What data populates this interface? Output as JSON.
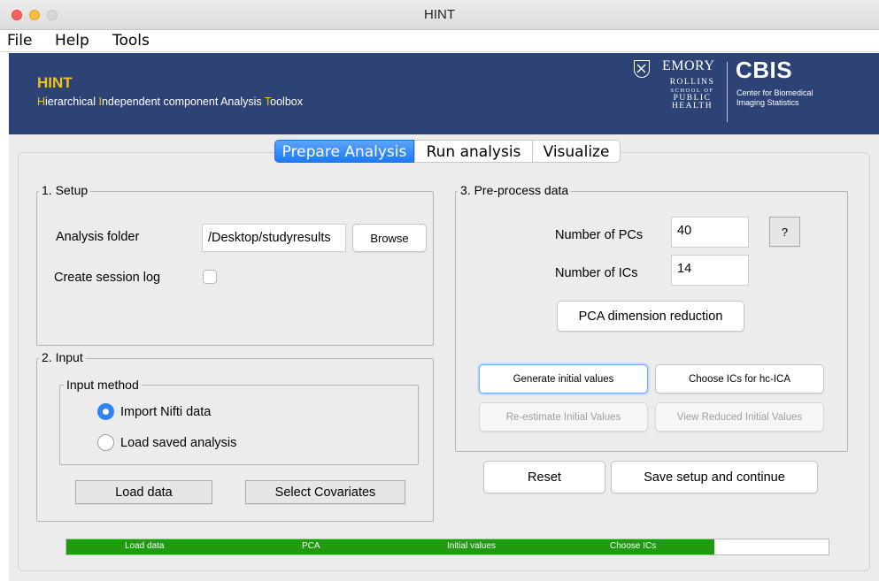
{
  "window": {
    "title": "HINT"
  },
  "menu": {
    "items": [
      "File",
      "Help",
      "Tools"
    ]
  },
  "banner": {
    "app_name": "HINT",
    "full_name_parts": [
      {
        "text": "H",
        "hl": true
      },
      {
        "text": "ierarchical ",
        "hl": false
      },
      {
        "text": "I",
        "hl": true
      },
      {
        "text": "ndependent component Analysis ",
        "hl": false
      },
      {
        "text": "T",
        "hl": true
      },
      {
        "text": "oolbox",
        "hl": false
      }
    ],
    "emory": "EMORY",
    "rollins_lines": [
      "ROLLINS",
      "SCHOOL OF",
      "PUBLIC",
      "HEALTH"
    ],
    "cbis": "CBIS",
    "cbis_sub_lines": [
      "Center for Biomedical",
      "Imaging Statistics"
    ]
  },
  "tabs": [
    {
      "label": "Prepare Analysis",
      "active": true
    },
    {
      "label": "Run analysis",
      "active": false
    },
    {
      "label": "Visualize",
      "active": false
    }
  ],
  "setup": {
    "title": "1. Setup",
    "folder_label": "Analysis folder",
    "folder_value": "/Desktop/studyresults",
    "browse_label": "Browse",
    "session_log_label": "Create session log",
    "session_log_checked": false
  },
  "input": {
    "title": "2. Input",
    "method_title": "Input method",
    "options": [
      {
        "label": "Import Nifti data",
        "selected": true
      },
      {
        "label": "Load saved analysis",
        "selected": false
      }
    ],
    "load_data_label": "Load data",
    "covariates_label": "Select Covariates"
  },
  "preprocess": {
    "title": "3. Pre-process data",
    "num_pcs_label": "Number of PCs",
    "num_pcs_value": "40",
    "help_label": "?",
    "num_ics_label": "Number of ICs",
    "num_ics_value": "14",
    "pca_label": "PCA dimension reduction",
    "generate_label": "Generate initial values",
    "choose_ics_label": "Choose ICs for hc-ICA",
    "reestimate_label": "Re-estimate Initial Values",
    "view_reduced_label": "View Reduced Initial Values"
  },
  "actions": {
    "reset_label": "Reset",
    "save_label": "Save setup and continue"
  },
  "progress": {
    "stages": [
      "Load data",
      "PCA",
      "Initial values",
      "Choose ICs"
    ],
    "completed_fraction": 0.85,
    "color": "#1f9a11"
  },
  "colors": {
    "banner": "#2d4376",
    "accent": "#f2c21b",
    "tab_active": "#1c7bf6"
  }
}
